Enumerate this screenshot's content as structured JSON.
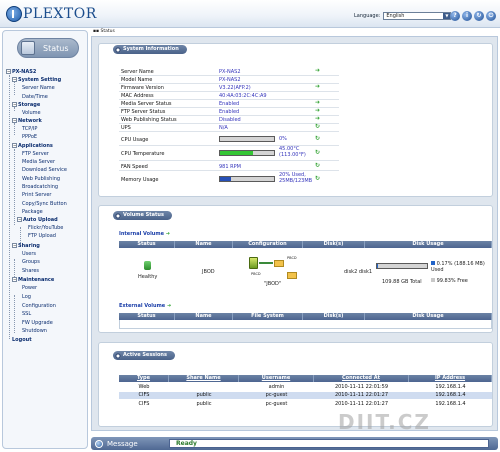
{
  "header": {
    "logo_text": "PLEXTOR",
    "language_label": "Language:",
    "language_value": "English",
    "icons": [
      "help-icon",
      "info-icon",
      "refresh-icon",
      "logout-icon"
    ],
    "icon_glyphs": [
      "?",
      "i",
      "↻",
      "⏻"
    ]
  },
  "nav": {
    "status_label": "Status",
    "items": [
      {
        "label": "PX-NAS2"
      },
      {
        "label": "System Setting"
      },
      {
        "label": "Server Name"
      },
      {
        "label": "Date/Time"
      },
      {
        "label": "Storage"
      },
      {
        "label": "Volume"
      },
      {
        "label": "Network"
      },
      {
        "label": "TCP/IP"
      },
      {
        "label": "PPPoE"
      },
      {
        "label": "Applications"
      },
      {
        "label": "FTP Server"
      },
      {
        "label": "Media Server"
      },
      {
        "label": "Download Service"
      },
      {
        "label": "Web Publishing"
      },
      {
        "label": "Broadcatching"
      },
      {
        "label": "Print Server"
      },
      {
        "label": "Copy/Sync Button"
      },
      {
        "label": "Package"
      },
      {
        "label": "Auto Upload"
      },
      {
        "label": "Flickr/YouTube"
      },
      {
        "label": "FTP Upload"
      },
      {
        "label": "Sharing"
      },
      {
        "label": "Users"
      },
      {
        "label": "Groups"
      },
      {
        "label": "Shares"
      },
      {
        "label": "Maintenance"
      },
      {
        "label": "Power"
      },
      {
        "label": "Log"
      },
      {
        "label": "Configuration"
      },
      {
        "label": "SSL"
      },
      {
        "label": "FW Upgrade"
      },
      {
        "label": "Shutdown"
      },
      {
        "label": "Logout"
      }
    ]
  },
  "breadcrumb": "Status",
  "sysinfo": {
    "title": "System Information",
    "rows": [
      {
        "label": "Server Name",
        "value": "PX-NAS2"
      },
      {
        "label": "Model Name",
        "value": "PX-NAS2"
      },
      {
        "label": "Firmware Version",
        "value": "V3.22(AFP.2)"
      },
      {
        "label": "MAC Address",
        "value": "40:4A:03:2C:4C:A9"
      },
      {
        "label": "Media Server Status",
        "value": "Enabled"
      },
      {
        "label": "FTP Server Status",
        "value": "Enabled"
      },
      {
        "label": "Web Publishing Status",
        "value": "Disabled"
      },
      {
        "label": "UPS",
        "value": "N/A"
      }
    ],
    "cpu_usage_label": "CPU Usage",
    "cpu_usage_value": "0%",
    "cpu_usage_fraction": 0.0,
    "cpu_temp_label": "CPU Temperature",
    "cpu_temp_value_1": "45.00°C",
    "cpu_temp_value_2": "(113.00°F)",
    "cpu_temp_fraction": 0.62,
    "fan_label": "FAN Speed",
    "fan_value": "981 RPM",
    "memory_label": "Memory Usage",
    "memory_value_1": "20% Used,",
    "memory_value_2": "25MB/123MB",
    "memory_fraction": 0.2,
    "colors": {
      "cpu_temp": "#35c635",
      "memory": "#2650b8"
    }
  },
  "volume": {
    "title": "Volume Status",
    "internal_label": "Internal Volume",
    "internal_headers": [
      "Status",
      "Name",
      "Configuration",
      "Disk(s)",
      "Disk Usage"
    ],
    "internal_row": {
      "status": "Healthy",
      "name": "JBOD",
      "config_label": "\"JBOD\"",
      "disk_label_1": "PBCD",
      "disk_label_2": "PBCD",
      "disks": "disk2 disk1",
      "total": "109.88 GB Total",
      "used_pct": "0.17% (188.16 MB)",
      "used_label": "Used",
      "free_pct": "99.83% Free",
      "used_fraction": 0.0017
    },
    "external_label": "External Volume",
    "external_headers": [
      "Status",
      "Name",
      "File System",
      "Disk(s)",
      "Disk Usage"
    ]
  },
  "sessions": {
    "title": "Active Sessions",
    "headers": [
      "Type",
      "Share Name",
      "Username",
      "Connected At",
      "IP Address"
    ],
    "rows": [
      {
        "type": "Web",
        "share": "",
        "user": "admin",
        "time": "2010-11-11 22:01:59",
        "ip": "192.168.1.4"
      },
      {
        "type": "CIFS",
        "share": "public",
        "user": "pc-guest",
        "time": "2010-11-11 22:01:27",
        "ip": "192.168.1.4"
      },
      {
        "type": "CIFS",
        "share": "public",
        "user": "pc-guest",
        "time": "2010-11-11 22:01:27",
        "ip": "192.168.1.4"
      }
    ]
  },
  "footer": {
    "label": "Message",
    "message": "Ready"
  },
  "watermark": "DIIT.CZ"
}
